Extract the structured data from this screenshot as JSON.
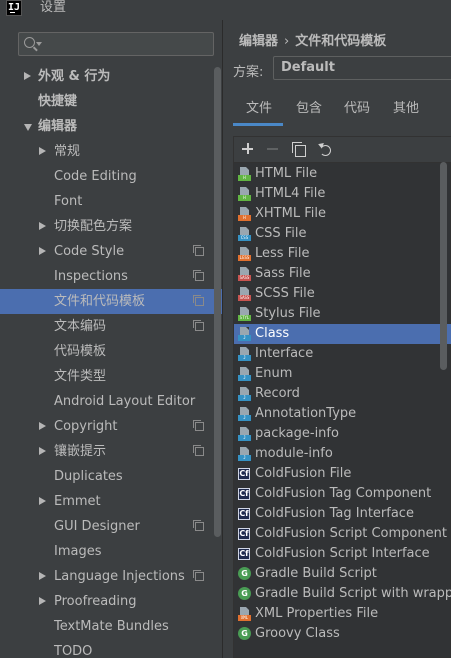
{
  "window": {
    "title": "设置",
    "app_icon_text": "IJ"
  },
  "search": {
    "placeholder": ""
  },
  "tree": [
    {
      "label": "外观 & 行为",
      "level": 0,
      "arrow": "right",
      "copy": false,
      "selected": false
    },
    {
      "label": "快捷键",
      "level": 0,
      "arrow": "none",
      "copy": false,
      "selected": false
    },
    {
      "label": "编辑器",
      "level": 0,
      "arrow": "down",
      "copy": false,
      "selected": false
    },
    {
      "label": "常规",
      "level": 1,
      "arrow": "right",
      "copy": false,
      "selected": false
    },
    {
      "label": "Code Editing",
      "level": 1,
      "arrow": "none",
      "copy": false,
      "selected": false
    },
    {
      "label": "Font",
      "level": 1,
      "arrow": "none",
      "copy": false,
      "selected": false
    },
    {
      "label": "切换配色方案",
      "level": 1,
      "arrow": "right",
      "copy": false,
      "selected": false
    },
    {
      "label": "Code Style",
      "level": 1,
      "arrow": "right",
      "copy": true,
      "selected": false
    },
    {
      "label": "Inspections",
      "level": 1,
      "arrow": "none",
      "copy": true,
      "selected": false
    },
    {
      "label": "文件和代码模板",
      "level": 1,
      "arrow": "none",
      "copy": true,
      "selected": true
    },
    {
      "label": "文本编码",
      "level": 1,
      "arrow": "none",
      "copy": true,
      "selected": false
    },
    {
      "label": "代码模板",
      "level": 1,
      "arrow": "none",
      "copy": false,
      "selected": false
    },
    {
      "label": "文件类型",
      "level": 1,
      "arrow": "none",
      "copy": false,
      "selected": false
    },
    {
      "label": "Android Layout Editor",
      "level": 1,
      "arrow": "none",
      "copy": false,
      "selected": false
    },
    {
      "label": "Copyright",
      "level": 1,
      "arrow": "right",
      "copy": true,
      "selected": false
    },
    {
      "label": "镶嵌提示",
      "level": 1,
      "arrow": "right",
      "copy": true,
      "selected": false
    },
    {
      "label": "Duplicates",
      "level": 1,
      "arrow": "none",
      "copy": false,
      "selected": false
    },
    {
      "label": "Emmet",
      "level": 1,
      "arrow": "right",
      "copy": false,
      "selected": false
    },
    {
      "label": "GUI Designer",
      "level": 1,
      "arrow": "none",
      "copy": true,
      "selected": false
    },
    {
      "label": "Images",
      "level": 1,
      "arrow": "none",
      "copy": false,
      "selected": false
    },
    {
      "label": "Language Injections",
      "level": 1,
      "arrow": "right",
      "copy": true,
      "selected": false
    },
    {
      "label": "Proofreading",
      "level": 1,
      "arrow": "right",
      "copy": false,
      "selected": false
    },
    {
      "label": "TextMate Bundles",
      "level": 1,
      "arrow": "none",
      "copy": false,
      "selected": false
    },
    {
      "label": "TODO",
      "level": 1,
      "arrow": "none",
      "copy": false,
      "selected": false
    }
  ],
  "breadcrumb": {
    "parent": "编辑器",
    "separator": "›",
    "current": "文件和代码模板"
  },
  "scheme": {
    "label": "方案:",
    "value": "Default"
  },
  "tabs": [
    {
      "label": "文件",
      "active": true
    },
    {
      "label": "包含",
      "active": false
    },
    {
      "label": "代码",
      "active": false
    },
    {
      "label": "其他",
      "active": false
    }
  ],
  "toolbar": [
    "add",
    "remove",
    "copy",
    "reset"
  ],
  "files": [
    {
      "name": "HTML File",
      "icon": "html-file-icon",
      "tag": "H",
      "color": "#62b543",
      "selected": false
    },
    {
      "name": "HTML4 File",
      "icon": "html-file-icon",
      "tag": "H",
      "color": "#62b543",
      "selected": false
    },
    {
      "name": "XHTML File",
      "icon": "xhtml-file-icon",
      "tag": "H",
      "color": "#e0702f",
      "selected": false
    },
    {
      "name": "CSS File",
      "icon": "css-file-icon",
      "tag": "CSS",
      "color": "#3592c4",
      "selected": false
    },
    {
      "name": "Less File",
      "icon": "less-file-icon",
      "tag": "LESS",
      "color": "#e0702f",
      "selected": false
    },
    {
      "name": "Sass File",
      "icon": "sass-file-icon",
      "tag": "SASS",
      "color": "#c75450",
      "selected": false
    },
    {
      "name": "SCSS File",
      "icon": "scss-file-icon",
      "tag": "SASS",
      "color": "#c75450",
      "selected": false
    },
    {
      "name": "Stylus File",
      "icon": "stylus-file-icon",
      "tag": "STYL",
      "color": "#62b543",
      "selected": false
    },
    {
      "name": "Class",
      "icon": "java-file-icon",
      "tag": "J",
      "color": "#3592c4",
      "selected": true
    },
    {
      "name": "Interface",
      "icon": "java-file-icon",
      "tag": "J",
      "color": "#3592c4",
      "selected": false
    },
    {
      "name": "Enum",
      "icon": "java-file-icon",
      "tag": "J",
      "color": "#3592c4",
      "selected": false
    },
    {
      "name": "Record",
      "icon": "java-file-icon",
      "tag": "J",
      "color": "#3592c4",
      "selected": false
    },
    {
      "name": "AnnotationType",
      "icon": "java-file-icon",
      "tag": "J",
      "color": "#3592c4",
      "selected": false
    },
    {
      "name": "package-info",
      "icon": "java-file-icon",
      "tag": "J",
      "color": "#3592c4",
      "selected": false
    },
    {
      "name": "module-info",
      "icon": "java-file-icon",
      "tag": "J",
      "color": "#3592c4",
      "selected": false
    },
    {
      "name": "ColdFusion File",
      "icon": "coldfusion-file-icon",
      "tag": "Cf",
      "color": "#1f2a4d",
      "selected": false
    },
    {
      "name": "ColdFusion Tag Component",
      "icon": "coldfusion-file-icon",
      "tag": "Cf",
      "color": "#1f2a4d",
      "selected": false
    },
    {
      "name": "ColdFusion Tag Interface",
      "icon": "coldfusion-file-icon",
      "tag": "Cf",
      "color": "#1f2a4d",
      "selected": false
    },
    {
      "name": "ColdFusion Script Component",
      "icon": "coldfusion-file-icon",
      "tag": "Cf",
      "color": "#1f2a4d",
      "selected": false
    },
    {
      "name": "ColdFusion Script Interface",
      "icon": "coldfusion-file-icon",
      "tag": "Cf",
      "color": "#1f2a4d",
      "selected": false
    },
    {
      "name": "Gradle Build Script",
      "icon": "gradle-file-icon",
      "tag": "G",
      "color": "#499c54",
      "selected": false
    },
    {
      "name": "Gradle Build Script with wrapper",
      "icon": "gradle-file-icon",
      "tag": "G",
      "color": "#499c54",
      "selected": false
    },
    {
      "name": "XML Properties File",
      "icon": "xml-file-icon",
      "tag": "XML",
      "color": "#e0702f",
      "selected": false
    },
    {
      "name": "Groovy Class",
      "icon": "groovy-file-icon",
      "tag": "G",
      "color": "#499c54",
      "selected": false
    }
  ],
  "colors": {
    "background": "#3c3f41",
    "selection": "#4b6eaf",
    "list_background": "#313335",
    "tab_underline": "#4a88c7"
  }
}
